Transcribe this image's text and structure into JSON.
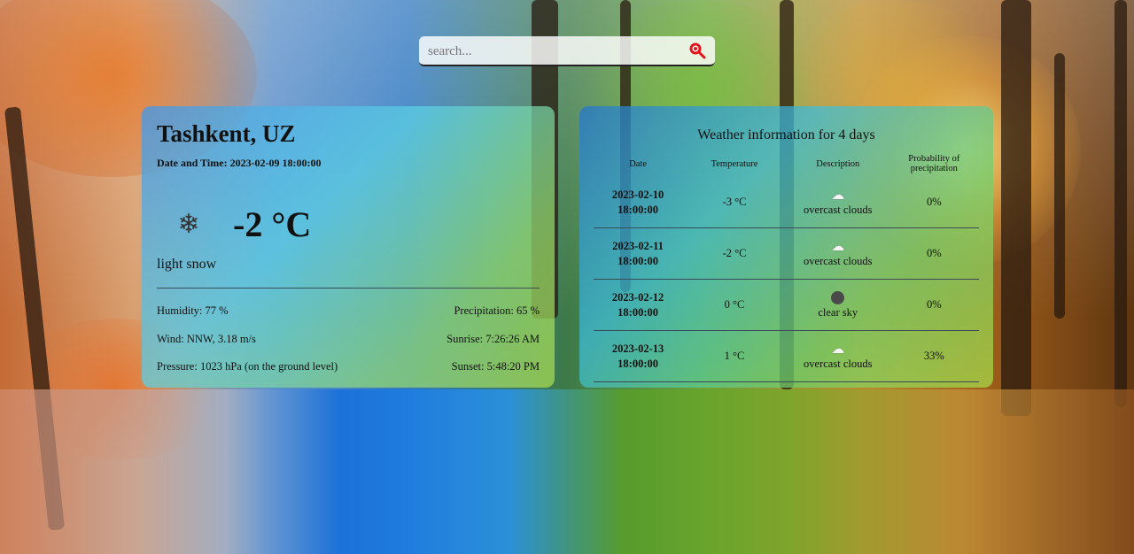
{
  "search": {
    "placeholder": "search...",
    "icon": "search-icon",
    "accent_color": "#e3131b"
  },
  "current": {
    "city": "Tashkent, UZ",
    "datetime_label": "Date and Time:",
    "datetime_value": "2023-02-09 18:00:00",
    "icon": "snowflake-icon",
    "temperature": "-2 °C",
    "condition": "light snow",
    "humidity": "Humidity: 77 %",
    "precipitation": "Precipitation: 65 %",
    "wind": "Wind: NNW, 3.18 m/s",
    "sunrise": "Sunrise: 7:26:26 AM",
    "pressure": "Pressure: 1023 hPa (on the ground level)",
    "sunset": "Sunset: 5:48:20 PM"
  },
  "forecast": {
    "title": "Weather information for 4 days",
    "headers": {
      "date": "Date",
      "temperature": "Temperature",
      "description": "Description",
      "pop_line1": "Probability of",
      "pop_line2": "precipitation"
    },
    "rows": [
      {
        "date": "2023-02-10",
        "time": "18:00:00",
        "temp": "-3 °C",
        "icon": "cloud-icon",
        "desc": "overcast clouds",
        "pop": "0%"
      },
      {
        "date": "2023-02-11",
        "time": "18:00:00",
        "temp": "-2 °C",
        "icon": "cloud-icon",
        "desc": "overcast clouds",
        "pop": "0%"
      },
      {
        "date": "2023-02-12",
        "time": "18:00:00",
        "temp": "0 °C",
        "icon": "clear-sky-icon",
        "desc": "clear sky",
        "pop": "0%"
      },
      {
        "date": "2023-02-13",
        "time": "18:00:00",
        "temp": "1 °C",
        "icon": "cloud-icon",
        "desc": "overcast clouds",
        "pop": "33%"
      }
    ]
  }
}
